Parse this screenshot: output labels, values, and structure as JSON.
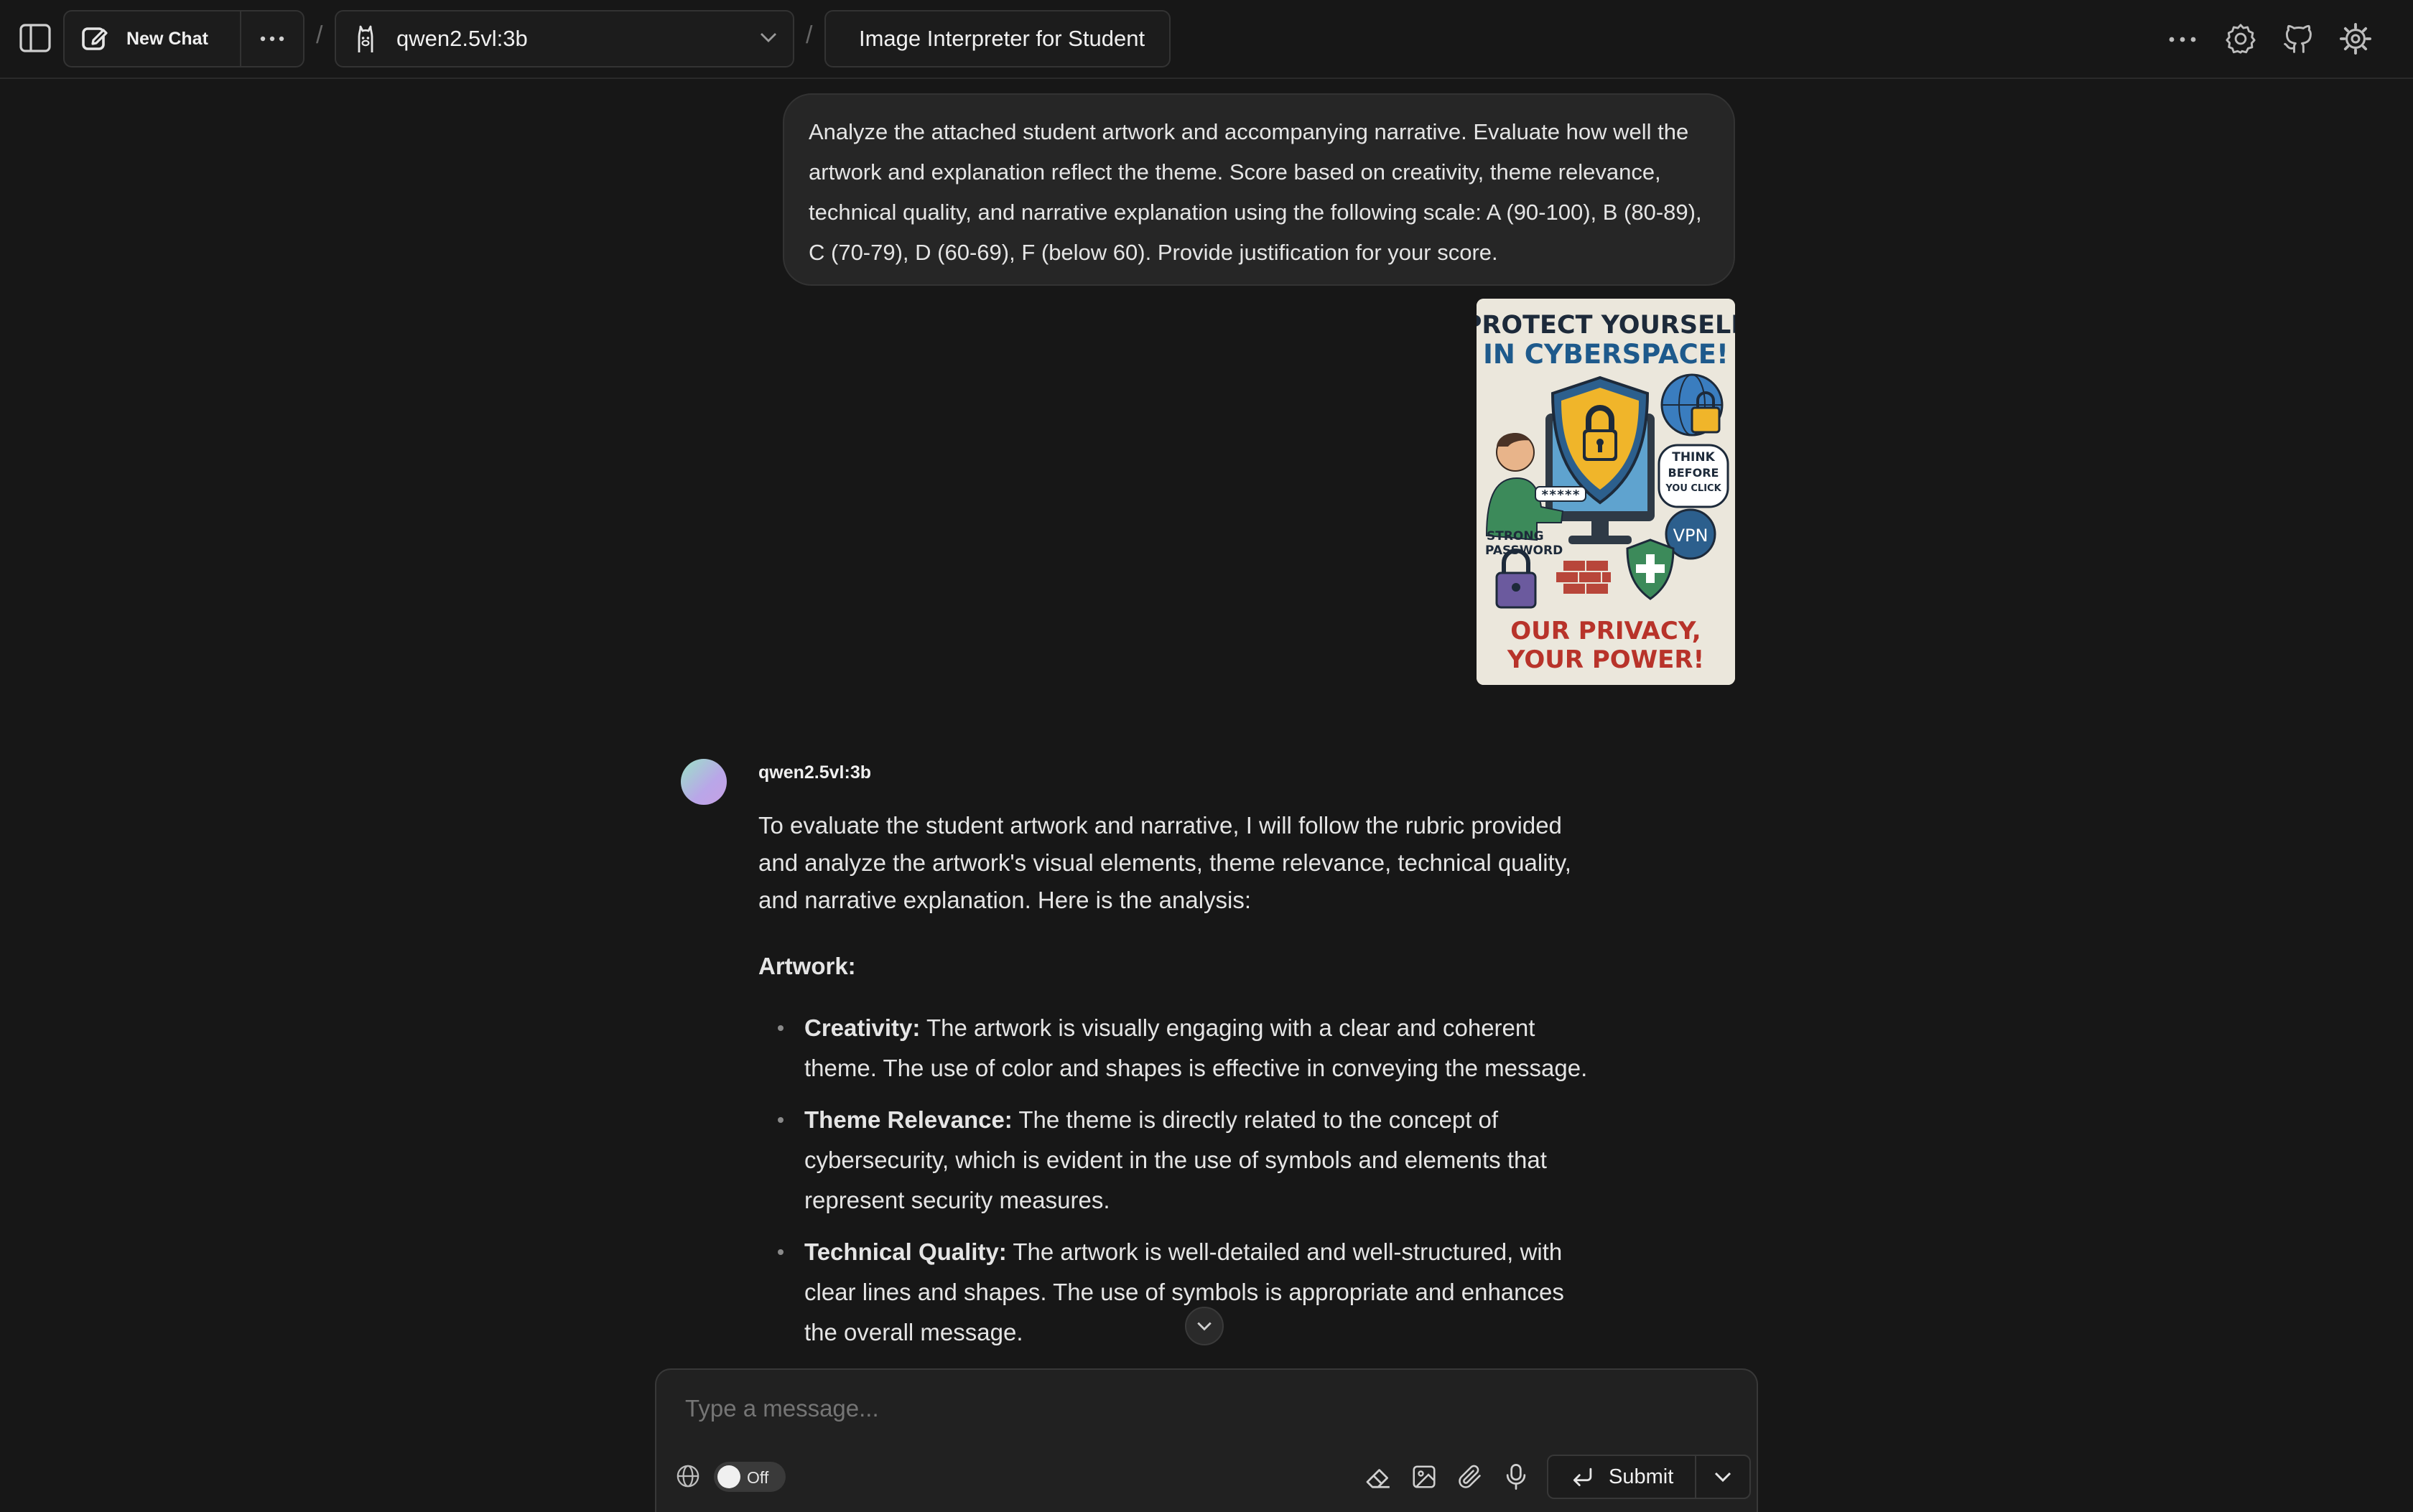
{
  "topbar": {
    "new_chat_label": "New Chat",
    "model_name": "qwen2.5vl:3b",
    "separator": "/",
    "chat_title": "Image Interpreter for Student"
  },
  "conversation": {
    "user_message": "Analyze the attached student artwork and accompanying narrative. Evaluate how well the artwork and explanation reflect the theme. Score based on creativity, theme relevance, technical quality, and narrative explanation using the following scale: A (90-100), B (80-89), C (70-79), D (60-69), F (below 60). Provide justification for your score.",
    "attachment": {
      "poster_title_line1": "PROTECT YOURSELF",
      "poster_title_line2": "IN CYBERSPACE!",
      "think_bubble_line1": "THINK",
      "think_bubble_line2": "BEFORE",
      "think_bubble_line3": "YOU CLICK",
      "vpn_label": "VPN",
      "password_mask": "*****",
      "strong_password_line1": "STRONG",
      "strong_password_line2": "PASSWORD",
      "poster_footer_line1": "OUR PRIVACY,",
      "poster_footer_line2": "YOUR POWER!"
    },
    "assistant_name": "qwen2.5vl:3b",
    "assistant_intro": "To evaluate the student artwork and narrative, I will follow the rubric provided and analyze the artwork's visual elements, theme relevance, technical quality, and narrative explanation. Here is the analysis:",
    "section_heading": "Artwork:",
    "bullets": [
      {
        "label": "Creativity:",
        "text": " The artwork is visually engaging with a clear and coherent theme. The use of color and shapes is effective in conveying the message."
      },
      {
        "label": "Theme Relevance:",
        "text": " The theme is directly related to the concept of cybersecurity, which is evident in the use of symbols and elements that represent security measures."
      },
      {
        "label": "Technical Quality:",
        "text": " The artwork is well-detailed and well-structured, with clear lines and shapes. The use of symbols is appropriate and enhances the overall message."
      }
    ]
  },
  "composer": {
    "placeholder": "Type a message...",
    "web_toggle_label": "Off",
    "submit_label": "Submit"
  },
  "colors": {
    "background": "#171717",
    "user_bubble": "#262626",
    "text": "#e5e5e5"
  }
}
